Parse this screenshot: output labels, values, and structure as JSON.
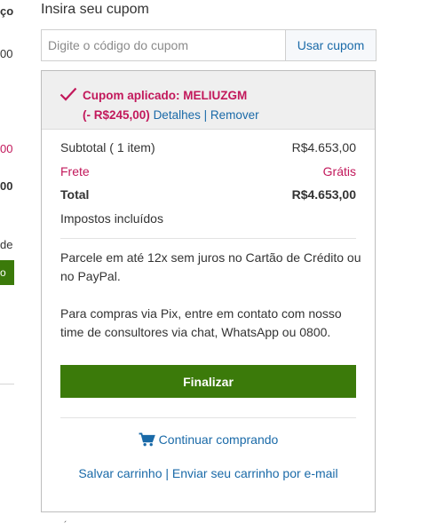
{
  "left_column": {
    "items": [
      {
        "text": "ço",
        "style": "bold"
      },
      {
        "text": "00",
        "style": "normal"
      },
      {
        "text": "00",
        "style": "red"
      },
      {
        "text": "00",
        "style": "bold"
      },
      {
        "text": "de",
        "style": "normal"
      }
    ],
    "button_label": "o"
  },
  "coupon": {
    "title": "Insira seu cupom",
    "placeholder": "Digite o código do cupom",
    "apply_label": "Usar cupom"
  },
  "applied": {
    "message": "Cupom aplicado: MELIUZGM",
    "discount": "(- R$245,00)",
    "details_label": "Detalhes",
    "separator": "|",
    "remove_label": "Remover"
  },
  "summary": {
    "subtotal_label": "Subtotal ( 1 item)",
    "subtotal_value": "R$4.653,00",
    "shipping_label": "Frete",
    "shipping_value": "Grátis",
    "total_label": "Total",
    "total_value": "R$4.653,00",
    "taxes_note": "Impostos incluídos"
  },
  "info": {
    "installments": "Parcele em até 12x sem juros no Cartão de Crédito ou no PayPal.",
    "pix": "Para compras via Pix, entre em contato com nosso time de consultores via chat, WhatsApp ou 0800."
  },
  "actions": {
    "finalize_label": "Finalizar",
    "continue_label": "Continuar comprando",
    "save_cart_label": "Salvar carrinho",
    "separator": "|",
    "email_cart_label": "Enviar seu carrinho por e-mail"
  },
  "footer_fragment": "´",
  "colors": {
    "accent_green": "#3b7a0a",
    "accent_red": "#c2185b",
    "link_blue": "#1a6aa8"
  },
  "icons": {
    "applied": "check-icon",
    "continue": "shopping-cart-icon"
  }
}
